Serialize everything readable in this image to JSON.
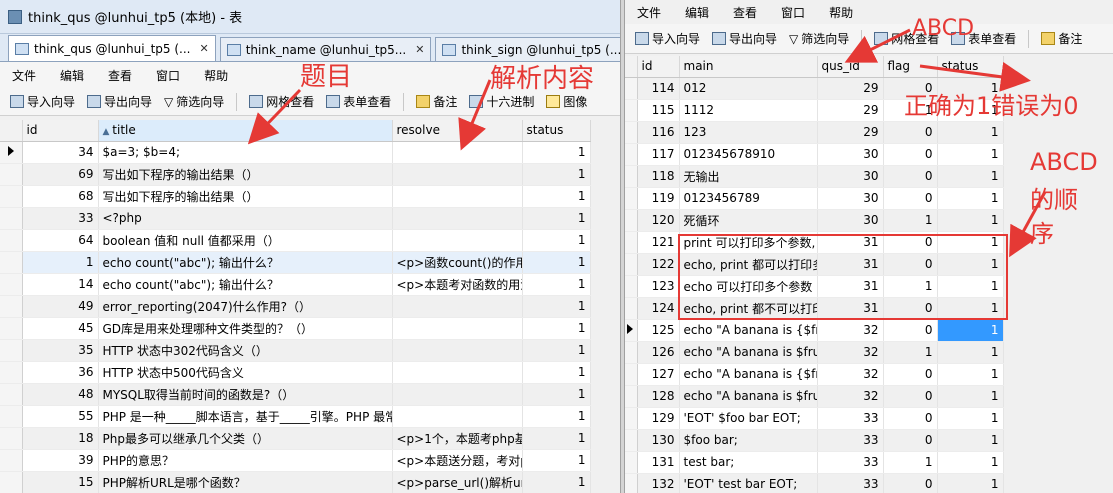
{
  "left": {
    "window_title": "think_qus @lunhui_tp5 (本地) - 表",
    "tabs": [
      "think_qus @lunhui_tp5 (...",
      "think_name @lunhui_tp5...",
      "think_sign @lunhui_tp5 (..."
    ],
    "menu": [
      "文件",
      "编辑",
      "查看",
      "窗口",
      "帮助"
    ],
    "toolbar": [
      "导入向导",
      "导出向导",
      "筛选向导",
      "网格查看",
      "表单查看",
      "备注",
      "十六进制",
      "图像"
    ],
    "columns": [
      "id",
      "title",
      "resolve",
      "status"
    ],
    "rows": [
      {
        "id": "34",
        "title": "$a=3; $b=4;",
        "resolve": "",
        "status": "1"
      },
      {
        "id": "69",
        "title": "写出如下程序的输出结果（）",
        "resolve": "",
        "status": "1"
      },
      {
        "id": "68",
        "title": "写出如下程序的输出结果（）",
        "resolve": "",
        "status": "1"
      },
      {
        "id": "33",
        "title": "<?php",
        "resolve": "",
        "status": "1"
      },
      {
        "id": "64",
        "title": "boolean 值和 null 值都采用（）",
        "resolve": "",
        "status": "1"
      },
      {
        "id": "1",
        "title": "echo count(\"abc\"); 输出什么？",
        "resolve": "<p>函数count()的作用",
        "status": "1"
      },
      {
        "id": "14",
        "title": "echo count(\"abc\"); 输出什么？",
        "resolve": "<p>本题考对函数的用法",
        "status": "1"
      },
      {
        "id": "49",
        "title": "error_reporting(2047)什么作用?（）",
        "resolve": "",
        "status": "1"
      },
      {
        "id": "45",
        "title": "GD库是用来处理哪种文件类型的？（）",
        "resolve": "",
        "status": "1"
      },
      {
        "id": "35",
        "title": "HTTP 状态中302代码含义（）",
        "resolve": "",
        "status": "1"
      },
      {
        "id": "36",
        "title": "HTTP 状态中500代码含义",
        "resolve": "",
        "status": "1"
      },
      {
        "id": "48",
        "title": "MYSQL取得当前时间的函数是?（）",
        "resolve": "",
        "status": "1"
      },
      {
        "id": "55",
        "title": "PHP 是一种_____脚本语言，基于_____引擎。PHP 最常",
        "resolve": "",
        "status": "1"
      },
      {
        "id": "18",
        "title": "Php最多可以继承几个父类（）",
        "resolve": "<p>1个，本题考php基",
        "status": "1"
      },
      {
        "id": "39",
        "title": "PHP的意思？",
        "resolve": "<p>本题送分题，考对p",
        "status": "1"
      },
      {
        "id": "15",
        "title": "PHP解析URL是哪个函数？",
        "resolve": "<p>parse_url()解析url",
        "status": "1"
      }
    ]
  },
  "right": {
    "menu": [
      "文件",
      "编辑",
      "查看",
      "窗口",
      "帮助"
    ],
    "toolbar": [
      "导入向导",
      "导出向导",
      "筛选向导",
      "网格查看",
      "表单查看",
      "备注"
    ],
    "columns": [
      "id",
      "main",
      "qus_id",
      "flag",
      "status"
    ],
    "rows": [
      {
        "id": "114",
        "main": "012",
        "qus_id": "29",
        "flag": "0",
        "status": "1"
      },
      {
        "id": "115",
        "main": "1112",
        "qus_id": "29",
        "flag": "1",
        "status": "1"
      },
      {
        "id": "116",
        "main": "123",
        "qus_id": "29",
        "flag": "0",
        "status": "1"
      },
      {
        "id": "117",
        "main": "012345678910",
        "qus_id": "30",
        "flag": "0",
        "status": "1"
      },
      {
        "id": "118",
        "main": "无输出",
        "qus_id": "30",
        "flag": "0",
        "status": "1"
      },
      {
        "id": "119",
        "main": "0123456789",
        "qus_id": "30",
        "flag": "0",
        "status": "1"
      },
      {
        "id": "120",
        "main": "死循环",
        "qus_id": "30",
        "flag": "1",
        "status": "1"
      },
      {
        "id": "121",
        "main": "print 可以打印多个参数,",
        "qus_id": "31",
        "flag": "0",
        "status": "1"
      },
      {
        "id": "122",
        "main": "echo, print 都可以打印多",
        "qus_id": "31",
        "flag": "0",
        "status": "1"
      },
      {
        "id": "123",
        "main": " echo 可以打印多个参数",
        "qus_id": "31",
        "flag": "1",
        "status": "1"
      },
      {
        "id": "124",
        "main": "echo, print 都不可以打印",
        "qus_id": "31",
        "flag": "0",
        "status": "1"
      },
      {
        "id": "125",
        "main": " echo \"A banana is {$fr",
        "qus_id": "32",
        "flag": "0",
        "status": "1"
      },
      {
        "id": "126",
        "main": "echo \"A banana is $fru",
        "qus_id": "32",
        "flag": "1",
        "status": "1"
      },
      {
        "id": "127",
        "main": "echo \"A banana is {$fru",
        "qus_id": "32",
        "flag": "0",
        "status": "1"
      },
      {
        "id": "128",
        "main": "echo \"A banana is $fru",
        "qus_id": "32",
        "flag": "0",
        "status": "1"
      },
      {
        "id": "129",
        "main": " 'EOT' $foo bar EOT;",
        "qus_id": "33",
        "flag": "0",
        "status": "1"
      },
      {
        "id": "130",
        "main": " $foo bar;",
        "qus_id": "33",
        "flag": "0",
        "status": "1"
      },
      {
        "id": "131",
        "main": " test bar;",
        "qus_id": "33",
        "flag": "1",
        "status": "1"
      },
      {
        "id": "132",
        "main": "'EOT' test bar EOT;",
        "qus_id": "33",
        "flag": "0",
        "status": "1"
      }
    ]
  },
  "annotations": {
    "title_label": "题目",
    "resolve_label": "解析内容",
    "abcd_label": "ABCD",
    "flag_label": "正确为1错误为0",
    "order_label_1": "ABCD",
    "order_label_2": "的顺",
    "order_label_3": "序"
  },
  "colors": {
    "annotation": "#e53935",
    "selection": "#3399ff"
  }
}
